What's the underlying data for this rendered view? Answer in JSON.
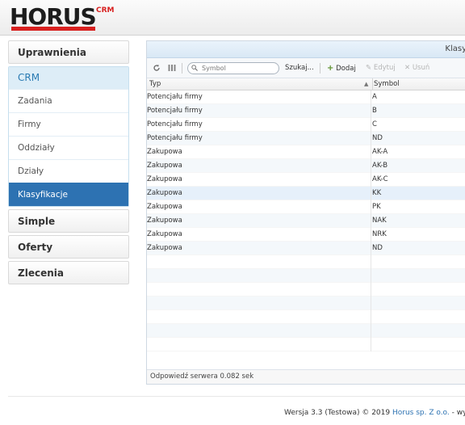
{
  "header": {
    "logo_text": "HORUS",
    "logo_sub": "CRM"
  },
  "sidebar": {
    "uprawnienia": "Uprawnienia",
    "crm": "CRM",
    "crm_items": [
      "Zadania",
      "Firmy",
      "Oddziały",
      "Działy",
      "Klasyfikacje"
    ],
    "active_item": "Klasyfikacje",
    "simple": "Simple",
    "oferty": "Oferty",
    "zlecenia": "Zlecenia"
  },
  "panel": {
    "title": "Klasy",
    "toolbar": {
      "search_placeholder": "Symbol",
      "search_button": "Szukaj...",
      "add": "Dodaj",
      "edit": "Edytuj",
      "delete": "Usuń"
    },
    "columns": [
      "Typ",
      "Symbol"
    ],
    "rows": [
      {
        "typ": "Potencjału firmy",
        "symbol": "A"
      },
      {
        "typ": "Potencjału firmy",
        "symbol": "B"
      },
      {
        "typ": "Potencjału firmy",
        "symbol": "C"
      },
      {
        "typ": "Potencjału firmy",
        "symbol": "ND"
      },
      {
        "typ": "Zakupowa",
        "symbol": "AK-A"
      },
      {
        "typ": "Zakupowa",
        "symbol": "AK-B"
      },
      {
        "typ": "Zakupowa",
        "symbol": "AK-C"
      },
      {
        "typ": "Zakupowa",
        "symbol": "KK"
      },
      {
        "typ": "Zakupowa",
        "symbol": "PK"
      },
      {
        "typ": "Zakupowa",
        "symbol": "NAK"
      },
      {
        "typ": "Zakupowa",
        "symbol": "NRK"
      },
      {
        "typ": "Zakupowa",
        "symbol": "ND"
      }
    ],
    "status": "Odpowiedź serwera 0.082 sek"
  },
  "footer": {
    "version": "Wersja 3.3 (Testowa) © 2019 ",
    "company": "Horus sp. Z o.o.",
    "suffix": " - wyk"
  }
}
